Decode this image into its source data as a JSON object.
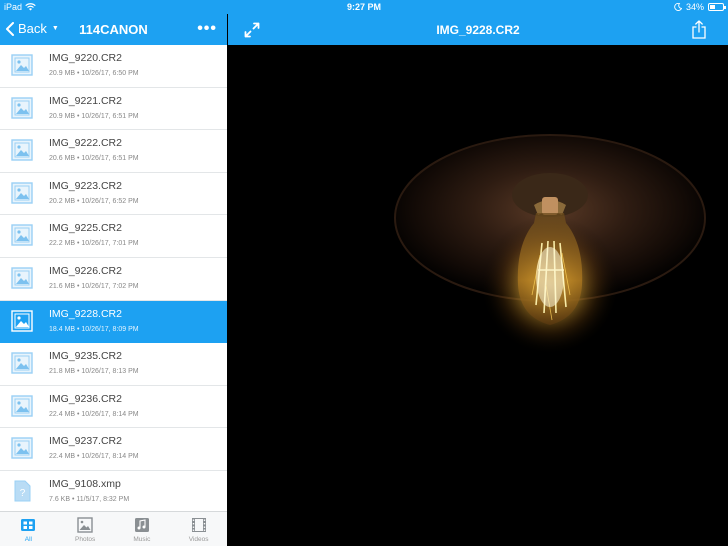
{
  "status_bar": {
    "device": "iPad",
    "time": "9:27 PM",
    "battery": "34%",
    "battery_level": 0.34
  },
  "left_nav": {
    "back_label": "Back",
    "folder_title": "114CANON",
    "more_label": "•••"
  },
  "files": [
    {
      "name": "IMG_9220.CR2",
      "meta": "20.9 MB • 10/26/17, 6:50 PM",
      "type": "image",
      "selected": false
    },
    {
      "name": "IMG_9221.CR2",
      "meta": "20.9 MB • 10/26/17, 6:51 PM",
      "type": "image",
      "selected": false
    },
    {
      "name": "IMG_9222.CR2",
      "meta": "20.6 MB • 10/26/17, 6:51 PM",
      "type": "image",
      "selected": false
    },
    {
      "name": "IMG_9223.CR2",
      "meta": "20.2 MB • 10/26/17, 6:52 PM",
      "type": "image",
      "selected": false
    },
    {
      "name": "IMG_9225.CR2",
      "meta": "22.2 MB • 10/26/17, 7:01 PM",
      "type": "image",
      "selected": false
    },
    {
      "name": "IMG_9226.CR2",
      "meta": "21.6 MB • 10/26/17, 7:02 PM",
      "type": "image",
      "selected": false
    },
    {
      "name": "IMG_9228.CR2",
      "meta": "18.4 MB • 10/26/17, 8:09 PM",
      "type": "image",
      "selected": true
    },
    {
      "name": "IMG_9235.CR2",
      "meta": "21.8 MB • 10/26/17, 8:13 PM",
      "type": "image",
      "selected": false
    },
    {
      "name": "IMG_9236.CR2",
      "meta": "22.4 MB • 10/26/17, 8:14 PM",
      "type": "image",
      "selected": false
    },
    {
      "name": "IMG_9237.CR2",
      "meta": "22.4 MB • 10/26/17, 8:14 PM",
      "type": "image",
      "selected": false
    },
    {
      "name": "IMG_9108.xmp",
      "meta": "7.6 KB • 11/5/17, 8:32 PM",
      "type": "unknown",
      "selected": false
    }
  ],
  "tabs": [
    {
      "label": "All",
      "icon": "grid-icon",
      "active": true
    },
    {
      "label": "Photos",
      "icon": "photo-icon",
      "active": false
    },
    {
      "label": "Music",
      "icon": "music-icon",
      "active": false
    },
    {
      "label": "Videos",
      "icon": "film-icon",
      "active": false
    }
  ],
  "right_nav": {
    "image_title": "IMG_9228.CR2"
  },
  "colors": {
    "accent": "#1da1f2",
    "selected_row": "#1da1f2",
    "photo_background": "#000000"
  }
}
